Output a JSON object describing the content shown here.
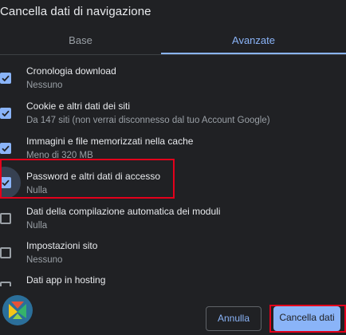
{
  "dialog": {
    "title": "Cancella dati di navigazione"
  },
  "tabs": {
    "basic": "Base",
    "advanced": "Avanzate"
  },
  "items": [
    {
      "label": "Cronologia download",
      "sub": "Nessuno",
      "checked": true
    },
    {
      "label": "Cookie e altri dati dei siti",
      "sub": "Da 147 siti (non verrai disconnesso dal tuo Account Google)",
      "checked": true
    },
    {
      "label": "Immagini e file memorizzati nella cache",
      "sub": "Meno di 320 MB",
      "checked": true
    },
    {
      "label": "Password e altri dati di accesso",
      "sub": "Nulla",
      "checked": true
    },
    {
      "label": "Dati della compilazione automatica dei moduli",
      "sub": "Nulla",
      "checked": false
    },
    {
      "label": "Impostazioni sito",
      "sub": "Nessuno",
      "checked": false
    },
    {
      "label": "Dati app in hosting",
      "sub": "",
      "checked": false
    }
  ],
  "buttons": {
    "cancel": "Annulla",
    "clear": "Cancella dati"
  },
  "colors": {
    "accent": "#8ab4f8",
    "highlight": "#e3001b",
    "background": "#202124"
  }
}
